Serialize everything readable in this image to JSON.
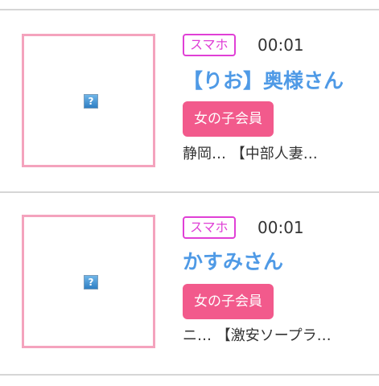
{
  "entries": [
    {
      "device_badge": "スマホ",
      "time": "00:01",
      "name": "【りお】奥様さん",
      "member_badge": "女の子会員",
      "description": "静岡… 【中部人妻…",
      "image_placeholder": "?"
    },
    {
      "device_badge": "スマホ",
      "time": "00:01",
      "name": "かすみさん",
      "member_badge": "女の子会員",
      "description": "ニ… 【激安ソープラ…",
      "image_placeholder": "?"
    }
  ],
  "colors": {
    "accent_name": "#4f9ae6",
    "badge_pink": "#f25a8c",
    "device_badge_magenta": "#e040d6",
    "thumb_border": "#f4a3bd",
    "divider": "#d6d6d6"
  }
}
